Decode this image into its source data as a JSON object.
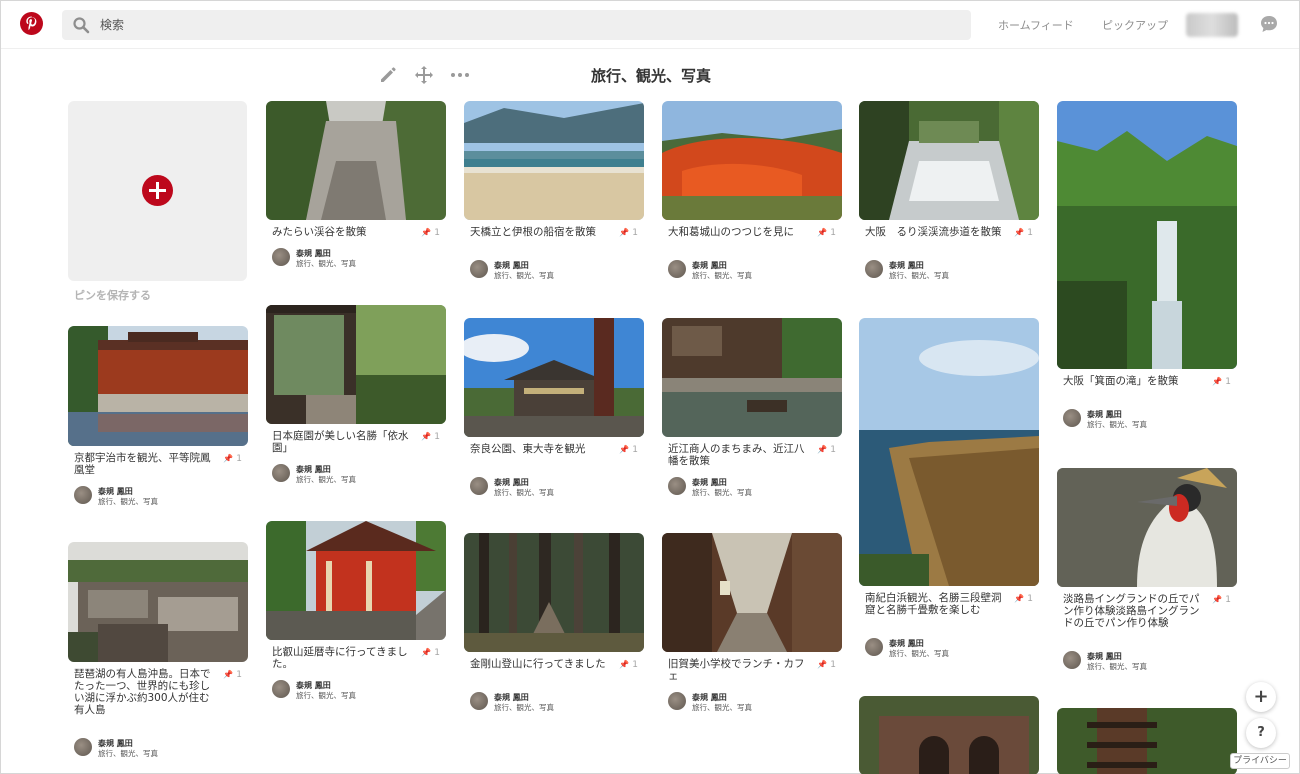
{
  "header": {
    "search_placeholder": "検索",
    "nav_home": "ホームフィード",
    "nav_pickup": "ピックアップ"
  },
  "board": {
    "title": "旅行、観光、写真",
    "save_pin_label": "ピンを保存する"
  },
  "pin_count": "1",
  "pin_glyph": "📌",
  "user": {
    "name": "泰規 鳳田",
    "board": "旅行、観光、写真"
  },
  "pins": [
    {
      "title": "みたらい渓谷を散策"
    },
    {
      "title": "天橋立と伊根の船宿を散策"
    },
    {
      "title": "大和葛城山のつつじを見に"
    },
    {
      "title": "大阪　るり渓渓流歩道を散策"
    },
    {
      "title": "大阪「箕面の滝」を散策"
    },
    {
      "title": "京都宇治市を観光、平等院鳳凰堂"
    },
    {
      "title": "日本庭園が美しい名勝「依水園」"
    },
    {
      "title": "奈良公園、東大寺を観光"
    },
    {
      "title": "近江商人のまちまみ、近江八幡を散策"
    },
    {
      "title": "南紀白浜観光、名勝三段壁洞窟と名勝千畳敷を楽しむ"
    },
    {
      "title": "淡路島イングランドの丘でパン作り体験淡路島イングランドの丘でパン作り体験"
    },
    {
      "title": "琵琶湖の有人島沖島。日本でたった一つ、世界的にも珍しい湖に浮かぶ約300人が住む有人島"
    },
    {
      "title": "比叡山延暦寺に行ってきました。"
    },
    {
      "title": "金剛山登山に行ってきました"
    },
    {
      "title": "旧賀美小学校でランチ・カフェ"
    }
  ],
  "fab": {
    "add": "+",
    "help": "?",
    "privacy": "プライバシー"
  }
}
